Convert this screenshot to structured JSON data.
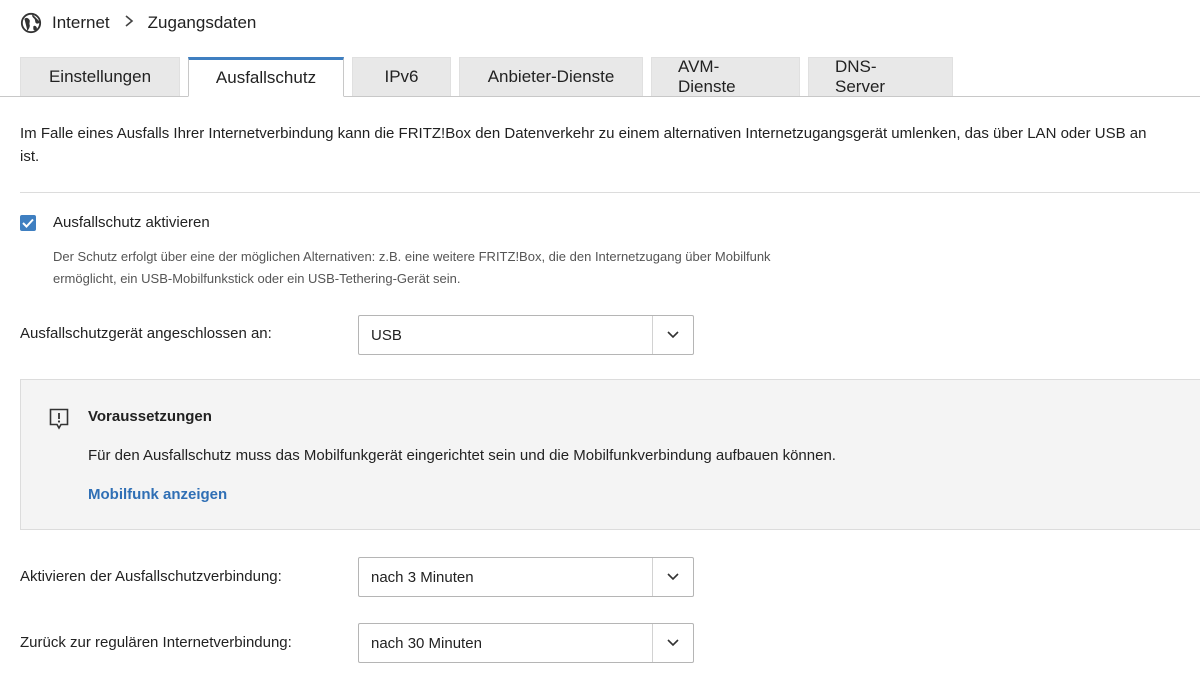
{
  "breadcrumb": {
    "icon": "globe-icon",
    "parent": "Internet",
    "current": "Zugangsdaten"
  },
  "tabs": [
    {
      "label": "Einstellungen",
      "active": false
    },
    {
      "label": "Ausfallschutz",
      "active": true
    },
    {
      "label": "IPv6",
      "active": false
    },
    {
      "label": "Anbieter-Dienste",
      "active": false
    },
    {
      "label": "AVM-Dienste",
      "active": false
    },
    {
      "label": "DNS-Server",
      "active": false
    }
  ],
  "intro": {
    "line1": "Im Falle eines Ausfalls Ihrer Internetverbindung kann die FRITZ!Box den Datenverkehr zu einem alternativen Internetzugangsgerät umlenken, das über LAN oder USB an",
    "line2": "ist."
  },
  "failover": {
    "checkbox_label": "Ausfallschutz aktivieren",
    "checked": true,
    "hint_line1": "Der Schutz erfolgt über eine der möglichen Alternativen: z.B. eine weitere FRITZ!Box, die den Internetzugang über Mobilfunk",
    "hint_line2": "ermöglicht, ein USB-Mobilfunkstick oder ein USB-Tethering-Gerät sein."
  },
  "device_connection": {
    "label": "Ausfallschutzgerät angeschlossen an:",
    "value": "USB"
  },
  "requirements": {
    "icon": "alert-icon",
    "title": "Voraussetzungen",
    "text": "Für den Ausfallschutz muss das Mobilfunkgerät eingerichtet sein und die Mobilfunkverbindung aufbauen können.",
    "link": "Mobilfunk anzeigen"
  },
  "activate_after": {
    "label": "Aktivieren der Ausfallschutzverbindung:",
    "value": "nach 3 Minuten"
  },
  "return_after": {
    "label": "Zurück zur regulären Internetverbindung:",
    "value": "nach 30 Minuten"
  },
  "colors": {
    "accent": "#3f7fc1",
    "link": "#2f6fb5",
    "tab_inactive": "#e8e8e8",
    "info_background": "#f4f4f4"
  }
}
